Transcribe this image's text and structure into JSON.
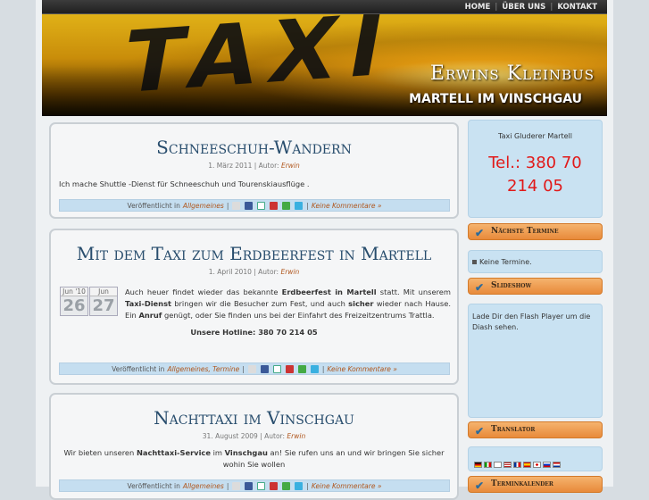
{
  "nav": {
    "home": "HOME",
    "about": "ÜBER UNS",
    "contact": "KONTAKT"
  },
  "header": {
    "photo_text": "TAXI",
    "title": "Erwins Kleinbus",
    "subtitle": "MARTELL IM VINSCHGAU"
  },
  "posts": [
    {
      "title": "Schneeschuh-Wandern",
      "date": "1. März 2011",
      "author_prefix": "| Autor:",
      "author": "Erwin",
      "body": "Ich mache Shuttle -Dienst für Schneeschuh und Tourenskiausflüge .",
      "published_prefix": "Veröffentlicht in",
      "categories": "Allgemeines",
      "comments": "Keine Kommentare »"
    },
    {
      "title": "Mit dem Taxi zum Erdbeerfest in Martell",
      "date": "1. April 2010",
      "author_prefix": "| Autor:",
      "author": "Erwin",
      "date_boxes": [
        {
          "month": "Jun '10",
          "day": "26"
        },
        {
          "month": "Jun",
          "day": "27"
        }
      ],
      "body_parts": [
        "Auch heuer findet wieder das bekannte ",
        "Erdbeerfest in Martell",
        " statt. Mit unserem ",
        "Taxi-Dienst",
        " bringen wir die Besucher zum Fest, und auch ",
        "sicher",
        " wieder nach Hause. Ein ",
        "Anruf",
        " genügt, oder Sie finden uns bei der Einfahrt des Freizeitzentrums Trattla."
      ],
      "hotline": "Unsere Hotline: 380 70 214 05",
      "published_prefix": "Veröffentlicht in",
      "categories": "Allgemeines, Termine",
      "comments": "Keine Kommentare »"
    },
    {
      "title": "Nachttaxi im Vinschgau",
      "date": "31. August 2009",
      "author_prefix": "| Autor:",
      "author": "Erwin",
      "body_parts": [
        "Wir bieten unseren ",
        "Nachttaxi-Service",
        " im ",
        "Vinschgau",
        " an! Sie rufen uns an und wir bringen Sie sicher wohin Sie wollen"
      ],
      "published_prefix": "Veröffentlicht in",
      "categories": "Allgemeines",
      "comments": "Keine Kommentare »"
    }
  ],
  "sidebar": {
    "contact": {
      "label": "Taxi Gluderer Martell",
      "phone": "Tel.: 380 70 214 05"
    },
    "next_dates": {
      "heading": "Nächste Termine",
      "text": "Keine Termine."
    },
    "slideshow": {
      "heading": "Slideshow",
      "text": "Lade Dir den Flash Player um die Diash sehen."
    },
    "translator": {
      "heading": "Translator"
    },
    "calendar": {
      "heading": "Terminkalender"
    }
  },
  "colors": {
    "accent": "#284d6d",
    "link": "#b0561c",
    "phone": "#e11919",
    "sidebar_head": "#e88a3a",
    "sidebar_box": "#c9e2f2"
  },
  "icons": [
    "bookmark-icon",
    "facebook-icon",
    "google-icon",
    "digg-icon",
    "technorati-icon",
    "twitter-icon",
    "check-icon"
  ]
}
